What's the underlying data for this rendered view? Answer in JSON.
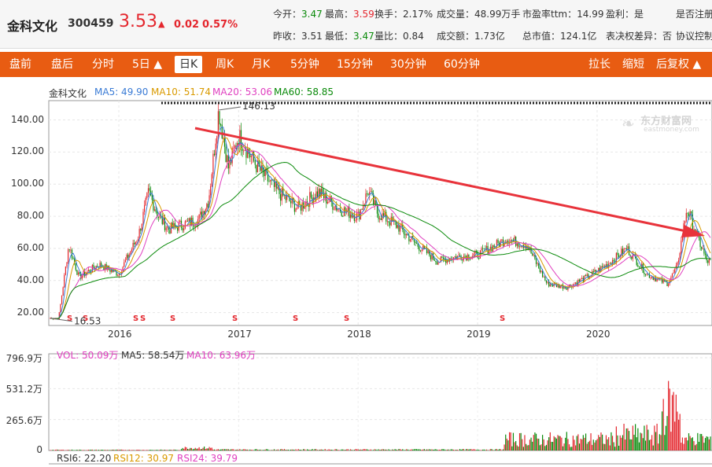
{
  "stock": {
    "name": "金科文化",
    "code": "300459",
    "price": "3.53",
    "arrow": "▲",
    "change": "0.02",
    "change_pct": "0.57%"
  },
  "quote": {
    "row1": [
      {
        "label": "今开：",
        "value": "3.47",
        "cls": "grn"
      },
      {
        "label": "最高：",
        "value": "3.59",
        "cls": "red"
      },
      {
        "label": "换手：",
        "value": "2.17%",
        "cls": ""
      },
      {
        "label": "成交量：",
        "value": "48.99万手",
        "cls": ""
      },
      {
        "label": "市盈率ttm：",
        "value": "14.99",
        "cls": ""
      },
      {
        "label": "盈利：",
        "value": "是",
        "cls": ""
      },
      {
        "label": "是否注册",
        "value": "",
        "cls": ""
      }
    ],
    "row2": [
      {
        "label": "昨收：",
        "value": "3.51",
        "cls": ""
      },
      {
        "label": "最低：",
        "value": "3.47",
        "cls": "grn"
      },
      {
        "label": "量比：",
        "value": "0.84",
        "cls": ""
      },
      {
        "label": "成交额：",
        "value": "1.73亿",
        "cls": ""
      },
      {
        "label": "总市值：",
        "value": "124.1亿",
        "cls": ""
      },
      {
        "label": "表决权差异：",
        "value": "否",
        "cls": ""
      },
      {
        "label": "协议控制",
        "value": "",
        "cls": ""
      }
    ]
  },
  "toolbar": {
    "items": [
      "盘前",
      "盘后",
      "分时",
      "5日 ▲",
      "日K",
      "周K",
      "月K",
      "5分钟",
      "15分钟",
      "30分钟",
      "60分钟"
    ],
    "right": [
      "拉长",
      "缩短",
      "后复权 ▲"
    ],
    "active": "日K"
  },
  "main_legend": {
    "name": "金科文化",
    "ma5": "MA5: 49.90",
    "ma10": "MA10: 51.74",
    "ma20": "MA20: 53.06",
    "ma60": "MA60: 58.85"
  },
  "volume_legend": {
    "vol": "VOL: 50.09万",
    "ma5": "MA5: 58.54万",
    "ma10": "MA10: 63.96万"
  },
  "rsi_legend": {
    "rsi6": "RSI6: 22.20",
    "rsi12": "RSI12: 30.97",
    "rsi24": "RSI24: 39.79"
  },
  "annotations": {
    "high": "146.13",
    "low": "16.53",
    "watermark_cn": "东方财富网",
    "watermark_en": "eastmoney.com",
    "dividend_mark": "S"
  },
  "colors": {
    "up": "#e4262d",
    "down": "#0a8a0a",
    "ma5": "#3a7bd5",
    "ma10": "#d99a00",
    "ma20": "#e040c0",
    "ma60": "#0a8a0a",
    "toolbar": "#e85c12"
  },
  "chart_data": [
    {
      "type": "candlestick",
      "title": "",
      "x_ticks": [
        "2016",
        "2017",
        "2018",
        "2019",
        "2020"
      ],
      "y_ticks": [
        "140.00",
        "120.00",
        "100.00",
        "80.00",
        "60.00",
        "40.00",
        "20.00"
      ],
      "ylim": [
        12,
        152
      ],
      "series": [
        {
          "name": "MA5",
          "value": 49.9
        },
        {
          "name": "MA10",
          "value": 51.74
        },
        {
          "name": "MA20",
          "value": 53.06
        },
        {
          "name": "MA60",
          "value": 58.85
        }
      ],
      "approx_close_path": {
        "x": [
          "2015-07",
          "2015-08",
          "2015-09",
          "2015-11",
          "2016-01",
          "2016-03",
          "2016-04",
          "2016-05",
          "2016-06",
          "2016-08",
          "2016-09",
          "2016-10",
          "2016-11",
          "2016-12",
          "2017-01",
          "2017-03",
          "2017-05",
          "2017-07",
          "2017-09",
          "2017-11",
          "2018-01",
          "2018-02",
          "2018-03",
          "2018-05",
          "2018-07",
          "2018-09",
          "2018-11",
          "2019-01",
          "2019-04",
          "2019-06",
          "2019-08",
          "2019-10",
          "2019-12",
          "2020-02",
          "2020-04",
          "2020-06",
          "2020-08",
          "2020-09",
          "2020-10",
          "2020-12"
        ],
        "y": [
          16.53,
          62,
          42,
          50,
          44,
          68,
          95,
          80,
          72,
          76,
          78,
          90,
          146.13,
          110,
          130,
          110,
          95,
          85,
          95,
          85,
          80,
          96,
          82,
          74,
          62,
          52,
          55,
          56,
          66,
          62,
          38,
          36,
          42,
          50,
          60,
          44,
          38,
          48,
          85,
          52
        ]
      },
      "annotations": [
        {
          "text": "146.13",
          "kind": "high"
        },
        {
          "text": "16.53",
          "kind": "low"
        }
      ]
    },
    {
      "type": "bar",
      "title": "VOL",
      "y_ticks": [
        "796.9万",
        "531.2万",
        "265.6万",
        "0"
      ],
      "ylim": [
        0,
        796.9
      ],
      "series": [
        {
          "name": "VOL",
          "value": 50.09
        },
        {
          "name": "MA5",
          "value": 58.54
        },
        {
          "name": "MA10",
          "value": 63.96
        }
      ]
    }
  ]
}
